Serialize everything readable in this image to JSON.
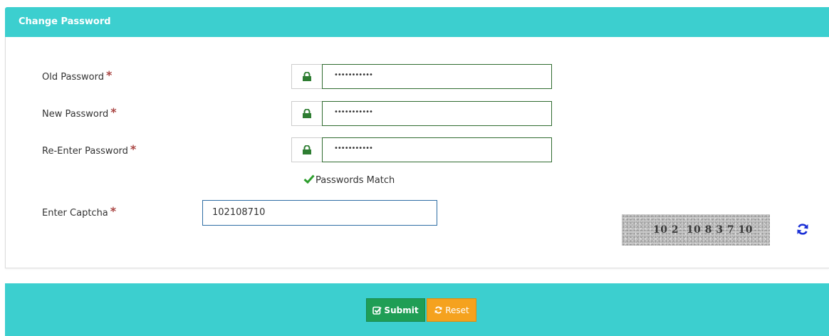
{
  "panel": {
    "title": "Change Password"
  },
  "form": {
    "fields": [
      {
        "label": "Old Password",
        "required_mark": "*",
        "value": "•••••••••••"
      },
      {
        "label": "New Password",
        "required_mark": "*",
        "value": "•••••••••••"
      },
      {
        "label": "Re-Enter Password",
        "required_mark": "*",
        "value": "•••••••••••"
      }
    ],
    "match_message": "Passwords Match",
    "captcha": {
      "label": "Enter Captcha",
      "required_mark": "*",
      "value": "102108710",
      "image_text": "10 2  10 8 3 7 10"
    }
  },
  "buttons": {
    "submit": "Submit",
    "reset": "Reset"
  },
  "icons": {
    "lock": "lock-icon",
    "check": "check-icon",
    "refresh": "refresh-icon",
    "submit": "check-square-icon",
    "reset": "refresh-icon"
  },
  "colors": {
    "header": "#3ccfcf",
    "required": "#a94442",
    "input_border": "#2f6b2f",
    "lock": "#2e7d32",
    "check": "#2e9e2e",
    "refresh": "#1a2fd6",
    "submit_bg": "#1f9e55",
    "reset_bg": "#f5a21e"
  }
}
